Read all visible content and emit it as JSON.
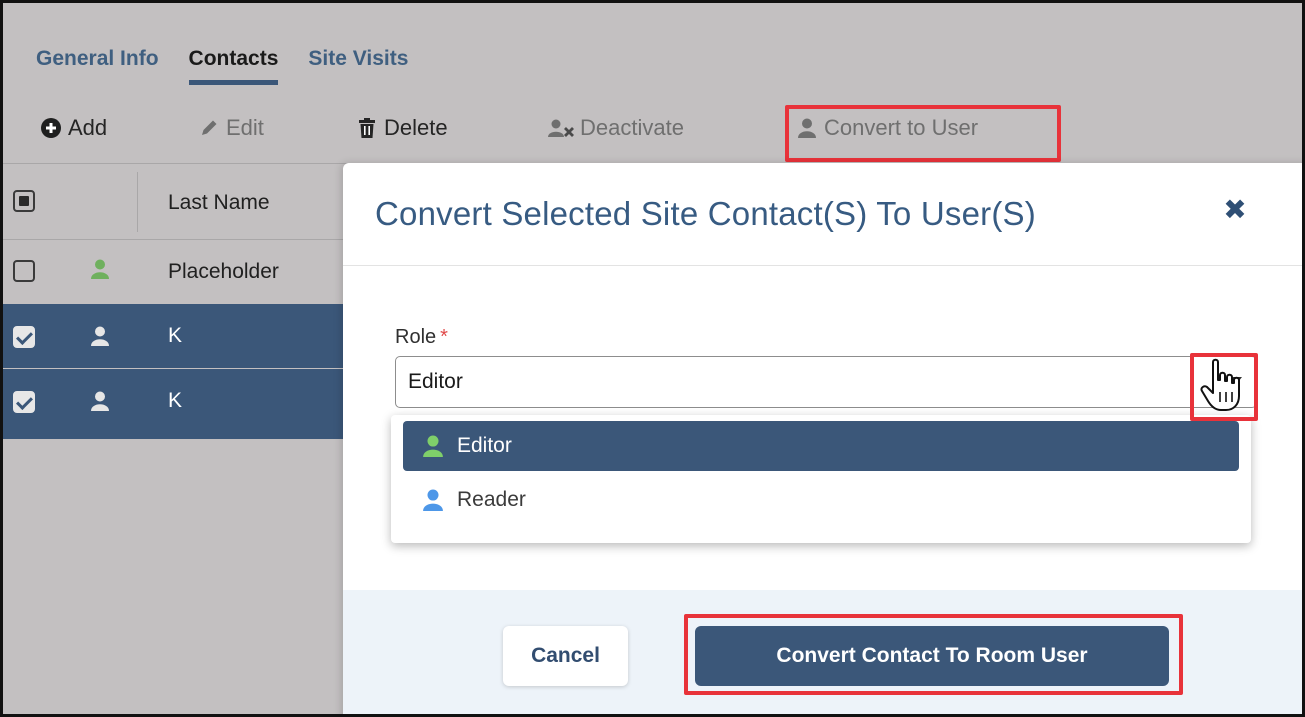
{
  "tabs": [
    {
      "label": "General Info"
    },
    {
      "label": "Contacts",
      "active": true
    },
    {
      "label": "Site Visits"
    }
  ],
  "toolbar": {
    "add": "Add",
    "edit": "Edit",
    "delete": "Delete",
    "deactivate": "Deactivate",
    "convert": "Convert to User"
  },
  "grid": {
    "column_last_name": "Last Name",
    "rows": [
      {
        "last_name": "Placeholder",
        "checked": false,
        "icon": "person-icon",
        "icon_color": "#6fb05e"
      },
      {
        "last_name": "K",
        "checked": true,
        "icon": "person-icon",
        "icon_color": "#e6e6e6"
      },
      {
        "last_name": "K",
        "checked": true,
        "icon": "person-icon",
        "icon_color": "#e6e6e6"
      }
    ]
  },
  "modal": {
    "title": "Convert Selected Site Contact(S) To User(S)",
    "close_icon": "close-icon",
    "role_label": "Role",
    "required_mark": "*",
    "role_value": "Editor",
    "options": [
      {
        "label": "Editor",
        "icon_color": "#7fcf6a",
        "selected": true
      },
      {
        "label": "Reader",
        "icon_color": "#4d97e8",
        "selected": false
      }
    ],
    "cancel": "Cancel",
    "convert": "Convert Contact To Room User"
  },
  "colors": {
    "accent": "#3b5779",
    "title": "#375b82",
    "highlight": "#e8323a",
    "overlay": "#c3c0c1"
  }
}
